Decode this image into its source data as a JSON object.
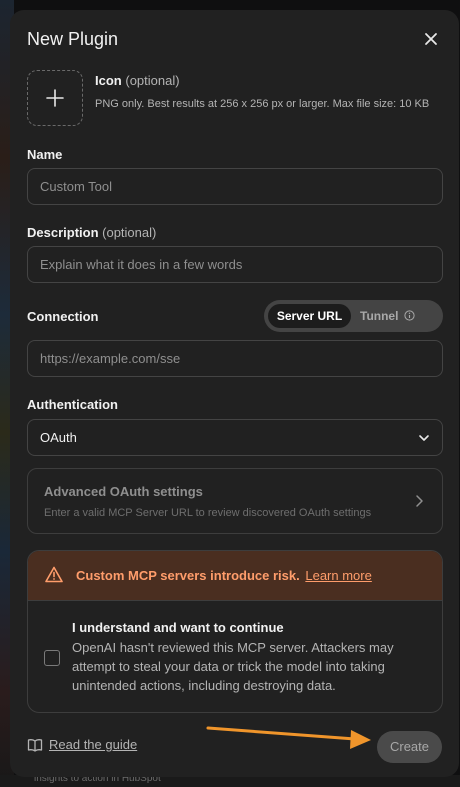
{
  "background": {
    "bottom_text": "insights to action in HubSpot"
  },
  "dialog": {
    "title": "New Plugin",
    "close_icon": "close-icon"
  },
  "icon_field": {
    "label": "Icon",
    "optional": "(optional)",
    "hint": "PNG only. Best results at 256 x 256 px or larger. Max file size: 10 KB",
    "upload_icon": "plus-icon"
  },
  "name_field": {
    "label": "Name",
    "placeholder": "Custom Tool"
  },
  "description_field": {
    "label": "Description",
    "optional": "(optional)",
    "placeholder": "Explain what it does in a few words"
  },
  "connection": {
    "label": "Connection",
    "tabs": [
      "Server URL",
      "Tunnel"
    ],
    "selected_tab": "Server URL",
    "url_placeholder": "https://example.com/sse",
    "tunnel_icon": "info-icon"
  },
  "authentication": {
    "label": "Authentication",
    "value": "OAuth",
    "chevron": "chevron-down-icon"
  },
  "advanced_oauth": {
    "title": "Advanced OAuth settings",
    "subtitle": "Enter a valid MCP Server URL to review discovered OAuth settings",
    "chevron": "chevron-right-icon"
  },
  "risk": {
    "warning_text": "Custom MCP servers introduce risk.",
    "learn_more": "Learn more",
    "warning_icon": "warning-icon",
    "checkbox_title": "I understand and want to continue",
    "checkbox_desc": "OpenAI hasn't reviewed this MCP server. Attackers may attempt to steal your data or trick the model into taking unintended actions, including destroying data.",
    "checked": false
  },
  "footer": {
    "guide_label": "Read the guide",
    "guide_icon": "book-icon",
    "create_label": "Create"
  },
  "colors": {
    "dialog_bg": "#212121",
    "warning_bg": "#4a2e20",
    "warning_text": "#ff9d6b",
    "annotation_arrow": "#f0952b"
  }
}
